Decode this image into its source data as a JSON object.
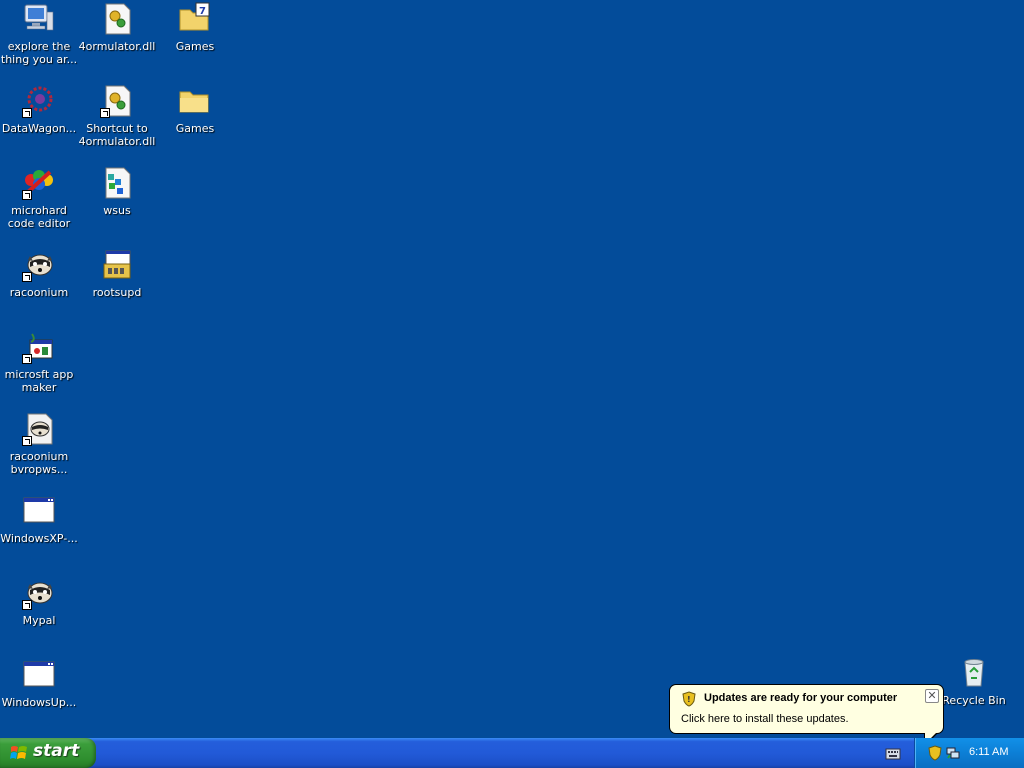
{
  "desktop": {
    "icons": [
      {
        "label": "explore the thing you ar...",
        "icon": "computer-icon"
      },
      {
        "label": "4ormulator.dll",
        "icon": "dll-file-icon"
      },
      {
        "label": "Games",
        "icon": "folder-icon"
      },
      {
        "label": "DataWagon...",
        "icon": "datawagon-icon"
      },
      {
        "label": "Shortcut to 4ormulator.dll",
        "icon": "dll-shortcut-icon"
      },
      {
        "label": "Games",
        "icon": "folder-icon"
      },
      {
        "label": "microhard code editor",
        "icon": "code-editor-icon"
      },
      {
        "label": "wsus",
        "icon": "wsus-icon"
      },
      {
        "label": "racoonium",
        "icon": "raccoon-icon"
      },
      {
        "label": "rootsupd",
        "icon": "installer-icon"
      },
      {
        "label": "microsft app maker",
        "icon": "app-maker-icon"
      },
      {
        "label": "racoonium bvropws...",
        "icon": "raccoon-doc-icon"
      },
      {
        "label": "WindowsXP-...",
        "icon": "window-icon"
      },
      {
        "label": "Mypal",
        "icon": "raccoon-icon"
      },
      {
        "label": "WindowsUp...",
        "icon": "window-icon"
      },
      {
        "label": "Recycle Bin",
        "icon": "recycle-bin-icon"
      }
    ]
  },
  "balloon": {
    "title": "Updates are ready for your computer",
    "body": "Click here to install these updates.",
    "close": "✕"
  },
  "taskbar": {
    "start_label": "start",
    "clock": "6:11 AM"
  },
  "colors": {
    "desktop": "#034c9a",
    "taskbar": "#245edb",
    "start": "#3b9e3b",
    "tray": "#0c7fd6",
    "balloon": "#ffffe1"
  }
}
